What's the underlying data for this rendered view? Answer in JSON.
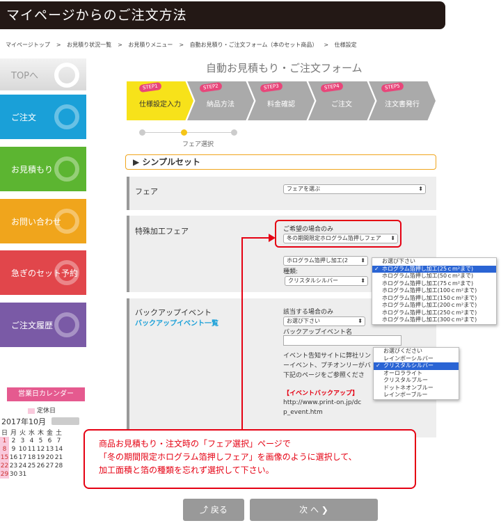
{
  "header": {
    "title": "マイページからのご注文方法"
  },
  "breadcrumb": [
    "マイページトップ",
    "お見積り状況一覧",
    "お見積りメニュー",
    "自動お見積り・ご注文フォーム（本のセット商品）",
    "仕様設定"
  ],
  "breadcrumb_sep": ">",
  "sidebar": {
    "top": "TOPへ",
    "items": [
      "ご注文",
      "お見積もり",
      "お問い合わせ",
      "急ぎのセット予約",
      "ご注文履歴"
    ]
  },
  "calendar": {
    "title": "営業日カレンダー",
    "legend": "定休日",
    "year_month": "2017年10月",
    "weekdays": [
      "日",
      "月",
      "火",
      "水",
      "木",
      "金",
      "土"
    ],
    "weeks": [
      [
        "1",
        "2",
        "3",
        "4",
        "5",
        "6",
        "7"
      ],
      [
        "8",
        "9",
        "10",
        "11",
        "12",
        "13",
        "14"
      ],
      [
        "15",
        "16",
        "17",
        "18",
        "19",
        "20",
        "21"
      ],
      [
        "22",
        "23",
        "24",
        "25",
        "26",
        "27",
        "28"
      ],
      [
        "29",
        "30",
        "31",
        "",
        "",
        "",
        ""
      ]
    ]
  },
  "form": {
    "title": "自動お見積もり・ご注文フォーム",
    "steps": [
      {
        "tag": "STEP1",
        "label": "仕様設定入力"
      },
      {
        "tag": "STEP2",
        "label": "納品方法"
      },
      {
        "tag": "STEP3",
        "label": "料金確認"
      },
      {
        "tag": "STEP4",
        "label": "ご注文"
      },
      {
        "tag": "STEP5",
        "label": "注文書発行"
      }
    ],
    "substep": "フェア選択",
    "set_name": "シンプルセット",
    "fair": {
      "label": "フェア",
      "select": "フェアを選ぶ"
    },
    "special": {
      "label": "特殊加工フェア",
      "note": "ご希望の場合のみ",
      "select": "冬の期間限定ホログラム箔押しフェア",
      "process_select": "ホログラム箔押し加工(2",
      "type_label": "種類:",
      "type_select": "クリスタルシルバー"
    },
    "process_options": [
      "お選び下さい",
      "ホログラム箔押し加工(25ｃm²まで)",
      "ホログラム箔押し加工(50ｃm²まで)",
      "ホログラム箔押し加工(75ｃm²まで)",
      "ホログラム箔押し加工(100ｃm²まで)",
      "ホログラム箔押し加工(150ｃm²まで)",
      "ホログラム箔押し加工(200ｃm²まで)",
      "ホログラム箔押し加工(250ｃm²まで)",
      "ホログラム箔押し加工(300ｃm²まで)"
    ],
    "type_options": [
      "お選びください",
      "レインボーシルバー",
      "クリスタルシルバー",
      "オーロラライト",
      "クリスタルブルー",
      "ドットネオンブルー",
      "レインボーブルー"
    ],
    "backup": {
      "label": "バックアップイベント",
      "link": "バックアップイベント一覧",
      "note": "該当する場合のみ",
      "select": "お選び下さい",
      "name_label": "バックアップイベント名",
      "desc1": "イベント告知サイトに弊社リン",
      "desc2": "ーイベント、プチオンリーがバ",
      "desc3": "下記のページをご参照くださ",
      "bracket": "【イベントバックアップ】",
      "url1": "http://www.print-on.jp/dc",
      "url2": "p_event.htm"
    }
  },
  "callout": {
    "lines": [
      "商品お見積もり・注文時の「フェア選択」ページで",
      "「冬の期間限定ホログラム箔押しフェア」を画像のように選択して、",
      "加工面積と箔の種類を忘れず選択して下さい。"
    ]
  },
  "buttons": {
    "back": "⤴ 戻る",
    "next": "次 へ ❯"
  }
}
